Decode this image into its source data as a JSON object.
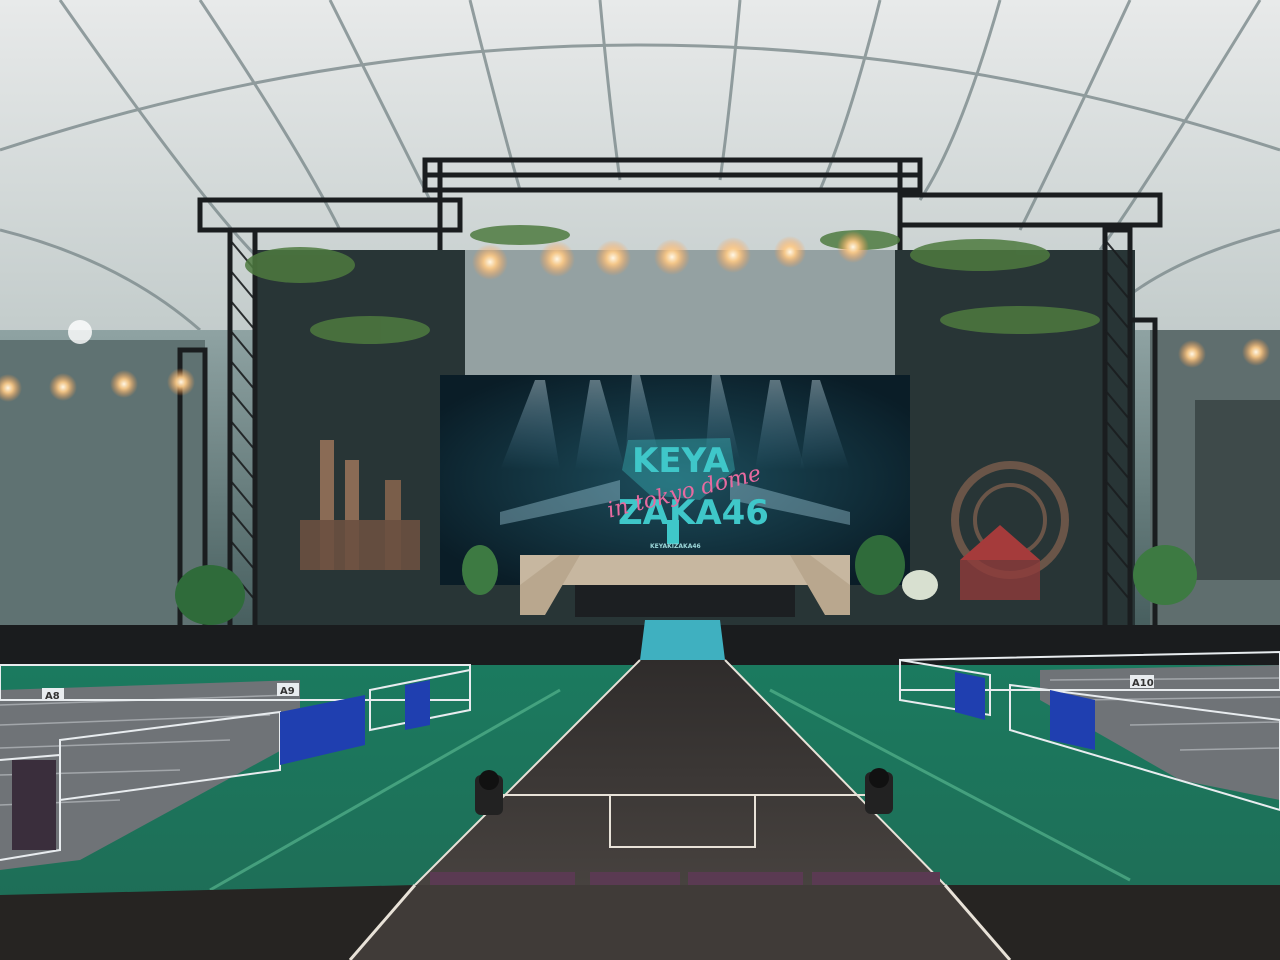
{
  "screen_logo": {
    "line1": "KEYA",
    "line2": "ZAKA46",
    "script": "in tokyo dome",
    "subline": "KEYAKIZAKA46"
  },
  "block_labels": {
    "left": "A8",
    "left_inner": "A9",
    "right": "A10"
  },
  "colors": {
    "floor": "#1f6b55",
    "tent": "#d9dcdc",
    "screen_bg": "#0e2a36",
    "logo_teal": "#3fc7c9",
    "logo_script": "#e86aa0",
    "runway": "#3d3a38",
    "barrier_blue": "#1f3fb0",
    "light_warm": "#ffcc88"
  }
}
